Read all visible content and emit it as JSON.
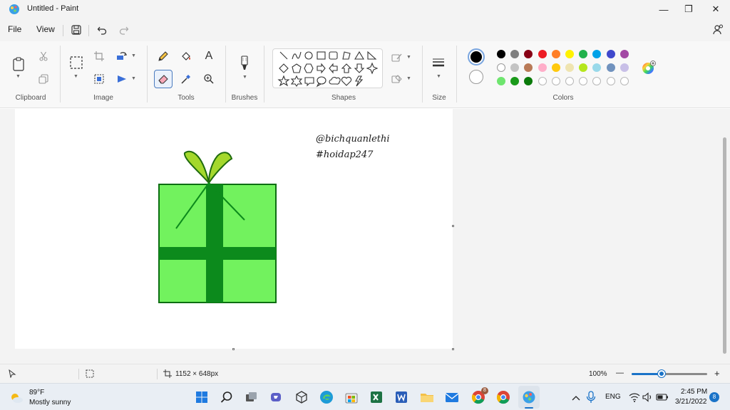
{
  "window": {
    "title": "Untitled - Paint",
    "minimize_glyph": "—",
    "restore_glyph": "❐",
    "close_glyph": "✕"
  },
  "menu": {
    "file": "File",
    "view": "View"
  },
  "ribbon": {
    "groups": {
      "clipboard": "Clipboard",
      "image": "Image",
      "tools": "Tools",
      "brushes": "Brushes",
      "shapes": "Shapes",
      "size": "Size",
      "colors": "Colors"
    },
    "text_tool_glyph": "A",
    "selected_tool": "eraser",
    "primary_color": "#000000",
    "secondary_color": "#ffffff",
    "palette_row1": [
      "#000000",
      "#7f7f7f",
      "#880015",
      "#ed1c24",
      "#ff7f27",
      "#fff200",
      "#22b14c",
      "#00a2e8",
      "#3f48cc",
      "#a349a4"
    ],
    "palette_row2": [
      "#ffffff",
      "#c3c3c3",
      "#b97a57",
      "#ffaec9",
      "#ffc90e",
      "#efe4b0",
      "#b5e61d",
      "#99d9ea",
      "#7092be",
      "#c8bfe7"
    ],
    "palette_row3": [
      "#6ee56e",
      "#1a9a1a",
      "#0a7a0a",
      "",
      "",
      "",
      "",
      "",
      "",
      ""
    ]
  },
  "canvas": {
    "text_line1": "@bichquanlethi",
    "text_line2": "#hoidap247",
    "gift_box_color": "#72f25e",
    "ribbon_color": "#0c8a1c",
    "bow_color": "#a4d82c"
  },
  "status": {
    "dimensions": "1152 × 648px",
    "zoom": "100%",
    "zoom_minus": "—",
    "zoom_plus": "+"
  },
  "taskbar": {
    "weather_temp": "89°F",
    "weather_desc": "Mostly sunny",
    "language": "ENG",
    "time": "2:45 PM",
    "date": "3/21/2022",
    "notification_count": "8",
    "teams_badge": "8"
  }
}
